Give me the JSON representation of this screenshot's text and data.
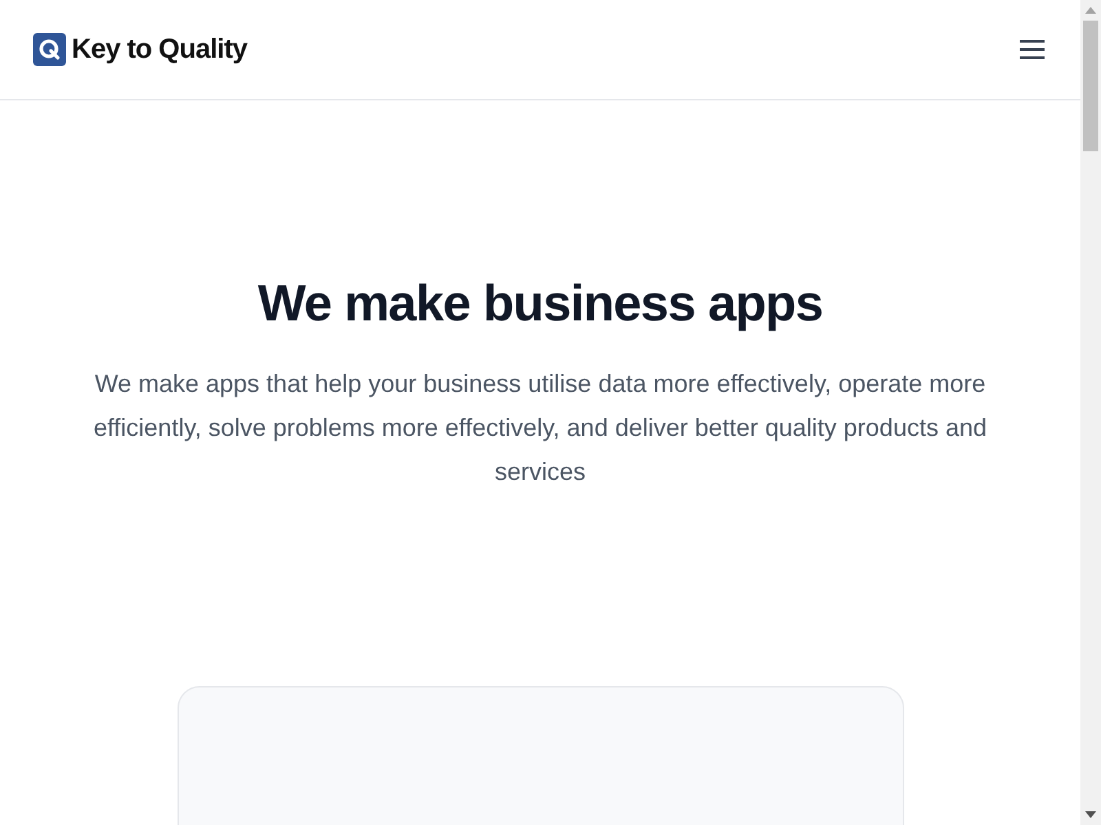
{
  "header": {
    "brand": "Key to Quality"
  },
  "hero": {
    "title": "We make business apps",
    "subtitle": "We make apps that help your business utilise data more effectively, operate more efficiently, solve problems more effectively, and deliver better quality products and services"
  }
}
